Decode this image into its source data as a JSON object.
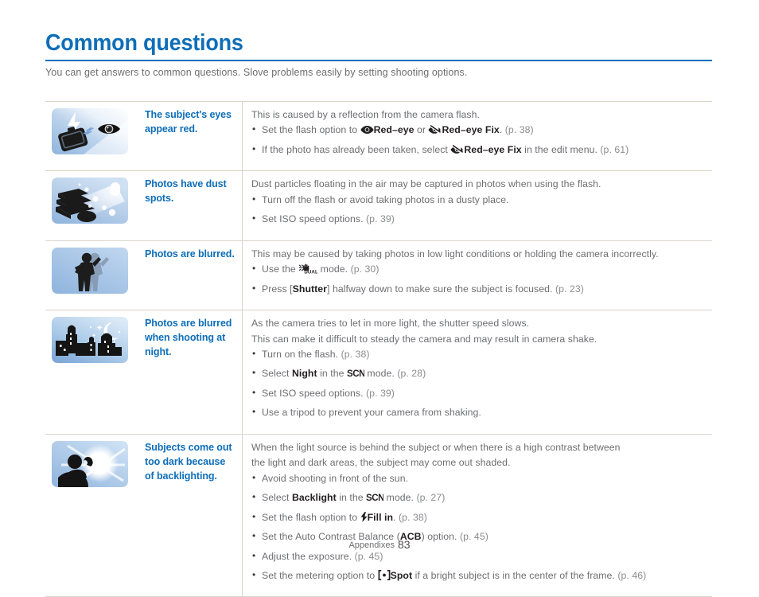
{
  "page": {
    "title": "Common questions",
    "intro": "You can get answers to common questions. Slove problems easily by setting shooting options.",
    "accent_color": "#0e6eb8",
    "body_text_color": "#6d6e71",
    "rule_color": "#d9d4c8",
    "footer_label": "Appendixes",
    "footer_page": "83"
  },
  "rows": [
    {
      "thumb_icon": "flash-red-eye-thumb",
      "question": "The subject's eyes appear red.",
      "intro": "This is caused by a reflection from the camera flash.",
      "bullets": [
        {
          "segments": [
            {
              "t": "text",
              "v": "Set the flash option to "
            },
            {
              "t": "icon",
              "v": "red-eye-icon"
            },
            {
              "t": "bold",
              "v": "Red–eye"
            },
            {
              "t": "text",
              "v": " or "
            },
            {
              "t": "icon",
              "v": "red-eye-fix-icon"
            },
            {
              "t": "bold",
              "v": "Red–eye Fix"
            },
            {
              "t": "text",
              "v": ". "
            },
            {
              "t": "page",
              "v": "(p. 38)"
            }
          ]
        },
        {
          "segments": [
            {
              "t": "text",
              "v": "If the photo has already been taken, select "
            },
            {
              "t": "icon",
              "v": "red-eye-fix-icon"
            },
            {
              "t": "bold",
              "v": "Red–eye Fix"
            },
            {
              "t": "text",
              "v": " in the edit menu. "
            },
            {
              "t": "page",
              "v": "(p. 61)"
            }
          ]
        }
      ]
    },
    {
      "thumb_icon": "dust-spots-thumb",
      "question": "Photos have dust spots.",
      "intro": "Dust particles floating in the air may be captured in photos when using the flash.",
      "bullets": [
        {
          "segments": [
            {
              "t": "text",
              "v": "Turn off the flash or avoid taking photos in a dusty place."
            }
          ]
        },
        {
          "segments": [
            {
              "t": "text",
              "v": "Set ISO speed options. "
            },
            {
              "t": "page",
              "v": "(p. 39)"
            }
          ]
        }
      ]
    },
    {
      "thumb_icon": "blurred-person-thumb",
      "question": "Photos are blurred.",
      "intro": "This may be caused by taking photos in low light conditions or holding the camera incorrectly.",
      "bullets": [
        {
          "segments": [
            {
              "t": "text",
              "v": "Use the "
            },
            {
              "t": "icon",
              "v": "dual-is-icon"
            },
            {
              "t": "text",
              "v": " mode. "
            },
            {
              "t": "page",
              "v": "(p. 30)"
            }
          ]
        },
        {
          "segments": [
            {
              "t": "text",
              "v": "Press ["
            },
            {
              "t": "bold",
              "v": "Shutter"
            },
            {
              "t": "text",
              "v": "] halfway down to make sure the subject is focused. "
            },
            {
              "t": "page",
              "v": "(p. 23)"
            }
          ]
        }
      ]
    },
    {
      "thumb_icon": "night-city-thumb",
      "question": "Photos are blurred when shooting at night.",
      "intro": "As the camera tries to let in more light, the shutter speed slows.",
      "intro2": "This can make it difficult to steady the camera and may result in camera shake.",
      "bullets": [
        {
          "segments": [
            {
              "t": "text",
              "v": "Turn on the flash. "
            },
            {
              "t": "page",
              "v": "(p. 38)"
            }
          ]
        },
        {
          "segments": [
            {
              "t": "text",
              "v": "Select "
            },
            {
              "t": "bold",
              "v": "Night"
            },
            {
              "t": "text",
              "v": " in the "
            },
            {
              "t": "icon",
              "v": "scn-icon"
            },
            {
              "t": "text",
              "v": " mode. "
            },
            {
              "t": "page",
              "v": "(p. 28)"
            }
          ]
        },
        {
          "segments": [
            {
              "t": "text",
              "v": "Set ISO speed options. "
            },
            {
              "t": "page",
              "v": "(p. 39)"
            }
          ]
        },
        {
          "segments": [
            {
              "t": "text",
              "v": "Use a tripod to prevent your camera from shaking."
            }
          ]
        }
      ]
    },
    {
      "thumb_icon": "backlight-person-thumb",
      "question": "Subjects come out too dark because of backlighting.",
      "intro": "When the light source is behind the subject or when there is a high contrast between",
      "intro2": "the light and dark areas, the subject may come out shaded.",
      "bullets": [
        {
          "segments": [
            {
              "t": "text",
              "v": "Avoid shooting in front of the sun."
            }
          ]
        },
        {
          "segments": [
            {
              "t": "text",
              "v": "Select "
            },
            {
              "t": "bold",
              "v": "Backlight"
            },
            {
              "t": "text",
              "v": " in the "
            },
            {
              "t": "icon",
              "v": "scn-icon"
            },
            {
              "t": "text",
              "v": " mode. "
            },
            {
              "t": "page",
              "v": "(p. 27)"
            }
          ]
        },
        {
          "segments": [
            {
              "t": "text",
              "v": "Set the flash option to "
            },
            {
              "t": "icon",
              "v": "fill-in-flash-icon"
            },
            {
              "t": "bold",
              "v": "Fill in"
            },
            {
              "t": "text",
              "v": ". "
            },
            {
              "t": "page",
              "v": "(p. 38)"
            }
          ]
        },
        {
          "segments": [
            {
              "t": "text",
              "v": "Set the Auto Contrast Balance ("
            },
            {
              "t": "bold",
              "v": "ACB"
            },
            {
              "t": "text",
              "v": ") option. "
            },
            {
              "t": "page",
              "v": "(p. 45)"
            }
          ]
        },
        {
          "segments": [
            {
              "t": "text",
              "v": "Adjust the exposure. "
            },
            {
              "t": "page",
              "v": "(p. 45)"
            }
          ]
        },
        {
          "segments": [
            {
              "t": "text",
              "v": "Set the metering option to "
            },
            {
              "t": "icon",
              "v": "spot-metering-icon"
            },
            {
              "t": "bold",
              "v": "Spot"
            },
            {
              "t": "text",
              "v": " if a bright subject is in the center of the frame. "
            },
            {
              "t": "page",
              "v": "(p. 46)"
            }
          ]
        }
      ]
    }
  ]
}
